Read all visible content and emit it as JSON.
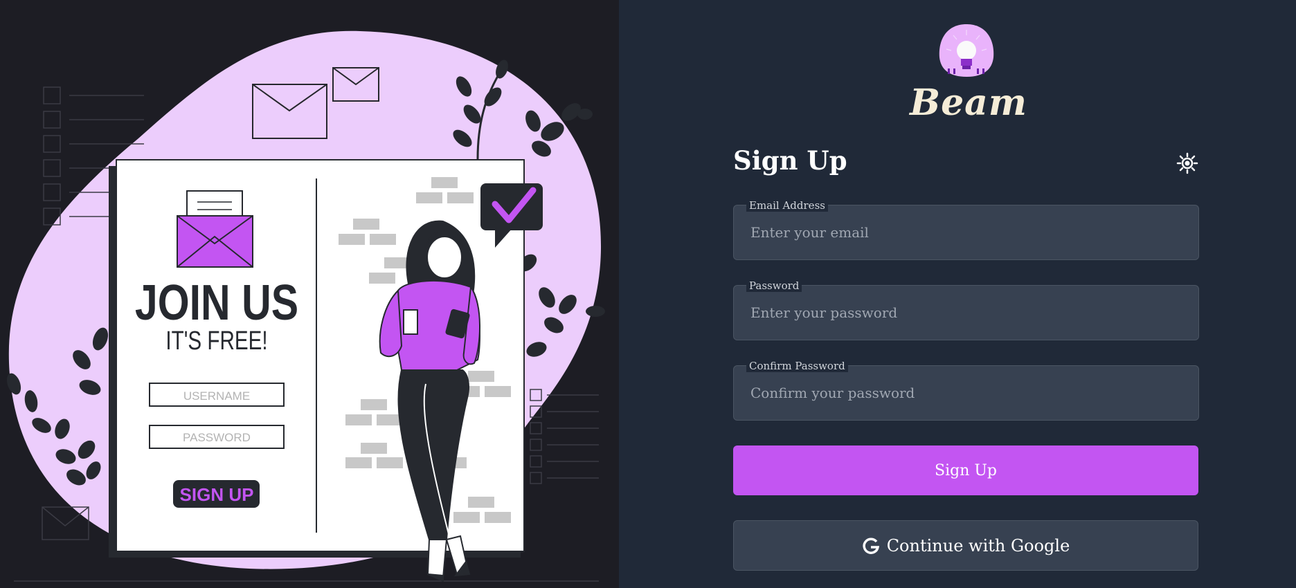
{
  "illustration": {
    "headline": "JOIN US",
    "subheadline": "IT'S FREE!",
    "username_placeholder": "USERNAME",
    "password_placeholder": "PASSWORD",
    "signup_label": "SIGN UP"
  },
  "brand": {
    "name": "Beam"
  },
  "form": {
    "title": "Sign Up",
    "email": {
      "label": "Email Address",
      "placeholder": "Enter your email",
      "value": ""
    },
    "password": {
      "label": "Password",
      "placeholder": "Enter your password",
      "value": ""
    },
    "confirm": {
      "label": "Confirm Password",
      "placeholder": "Confirm your password",
      "value": ""
    },
    "submit_label": "Sign Up",
    "google_label": "Continue with Google"
  },
  "icons": {
    "theme_toggle": "sun-icon",
    "google": "google-icon",
    "logo": "lightbulb-logo-icon"
  },
  "colors": {
    "accent": "#c355f2",
    "left_bg": "#1d1d24",
    "right_bg": "#202938",
    "input_bg": "#374151",
    "blob": "#eccdfc",
    "brand_text": "#f5ecd7"
  }
}
